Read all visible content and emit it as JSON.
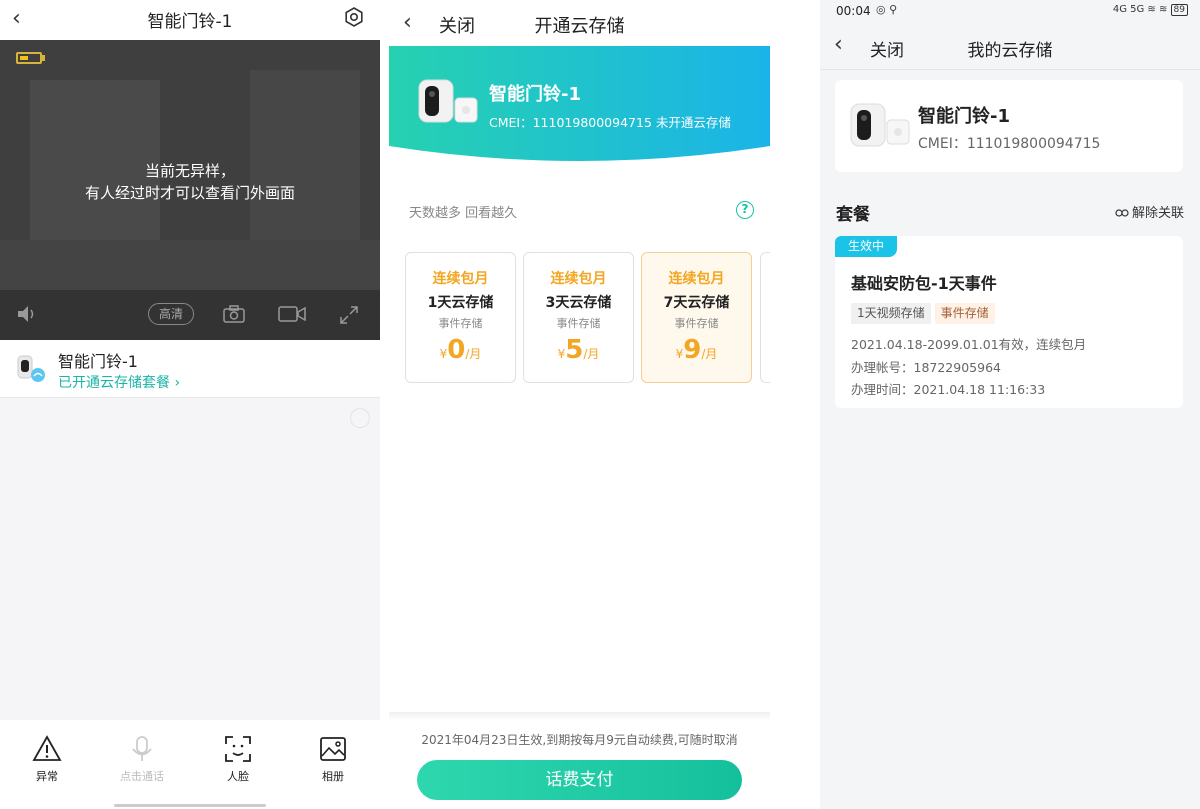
{
  "screen1": {
    "title": "智能门铃-1",
    "overlay_line1": "当前无异样，",
    "overlay_line2": "有人经过时才可以查看门外画面",
    "quality_label": "高清",
    "device_name": "智能门铃-1",
    "device_status": "已开通云存储套餐 ›",
    "tabs": [
      {
        "label": "异常",
        "icon": "warning-icon"
      },
      {
        "label": "点击通话",
        "icon": "microphone-icon"
      },
      {
        "label": "人脸",
        "icon": "face-scan-icon"
      },
      {
        "label": "相册",
        "icon": "photo-album-icon"
      }
    ]
  },
  "screen2": {
    "close_label": "关闭",
    "title": "开通云存储",
    "device_name": "智能门铃-1",
    "device_sub": "CMEI：111019800094715 未开通云存储",
    "hint": "天数越多 回看越久",
    "help": "?",
    "plans": [
      {
        "type": "连续包月",
        "days": "1天云存储",
        "event": "事件存储",
        "currency": "¥",
        "price": "0",
        "unit": "/月"
      },
      {
        "type": "连续包月",
        "days": "3天云存储",
        "event": "事件存储",
        "currency": "¥",
        "price": "5",
        "unit": "/月"
      },
      {
        "type": "连续包月",
        "days": "7天云存储",
        "event": "事件存储",
        "currency": "¥",
        "price": "9",
        "unit": "/月"
      }
    ],
    "footer_note": "2021年04月23日生效,到期按每月9元自动续费,可随时取消",
    "pay_button": "话费支付"
  },
  "screen3": {
    "status_time": "00:04",
    "status_net": "4G 5G",
    "battery": "89",
    "close_label": "关闭",
    "title": "我的云存储",
    "device_name": "智能门铃-1",
    "device_cmei": "CMEI：111019800094715",
    "section_title": "套餐",
    "unlink_label": "解除关联",
    "badge": "生效中",
    "plan_name": "基础安防包-1天事件",
    "tag1": "1天视频存储",
    "tag2": "事件存储",
    "validity": "2021.04.18-2099.01.01有效，连续包月",
    "account": "办理帐号：18722905964",
    "time": "办理时间：2021.04.18 11:16:33"
  },
  "colors": {
    "accent_teal": "#19b5a5",
    "price_orange": "#f3a622",
    "badge_blue": "#1bc3e6",
    "pay_green": "#14c09c"
  }
}
